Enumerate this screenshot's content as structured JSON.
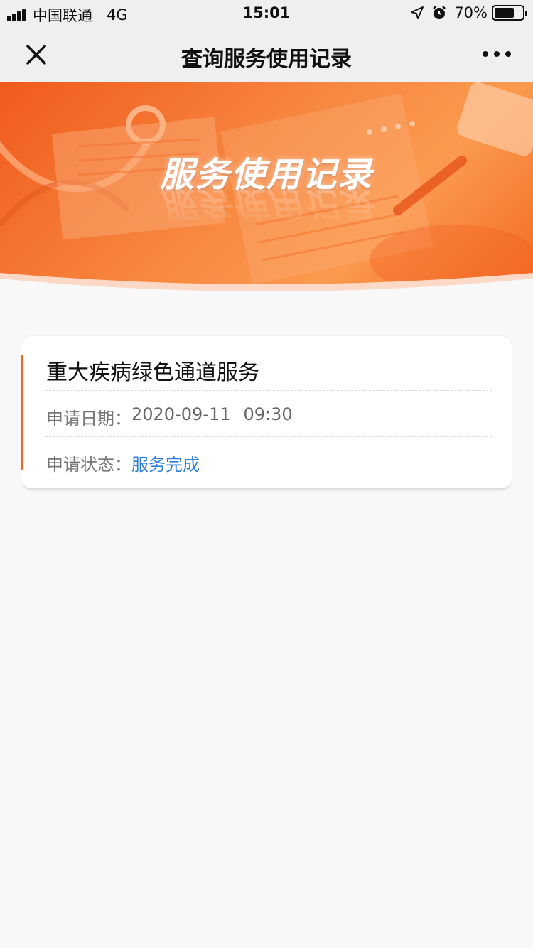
{
  "status_bar": {
    "carrier": "中国联通",
    "network": "4G",
    "time": "15:01",
    "battery_text": "70%",
    "battery_level": 0.7
  },
  "nav": {
    "title": "查询服务使用记录",
    "close_icon": "close-icon",
    "more_icon": "more-icon"
  },
  "banner": {
    "title": "服务使用记录"
  },
  "records": [
    {
      "title": "重大疾病绿色通道服务",
      "date_label": "申请日期：",
      "date_value": "2020-09-11",
      "time_value": "09:30",
      "status_label": "申请状态：",
      "status_value": "服务完成"
    }
  ],
  "colors": {
    "accent": "#f26a22",
    "status_link": "#2f7fd8",
    "banner_start": "#f05a1c",
    "banner_end": "#fb9a4e"
  }
}
